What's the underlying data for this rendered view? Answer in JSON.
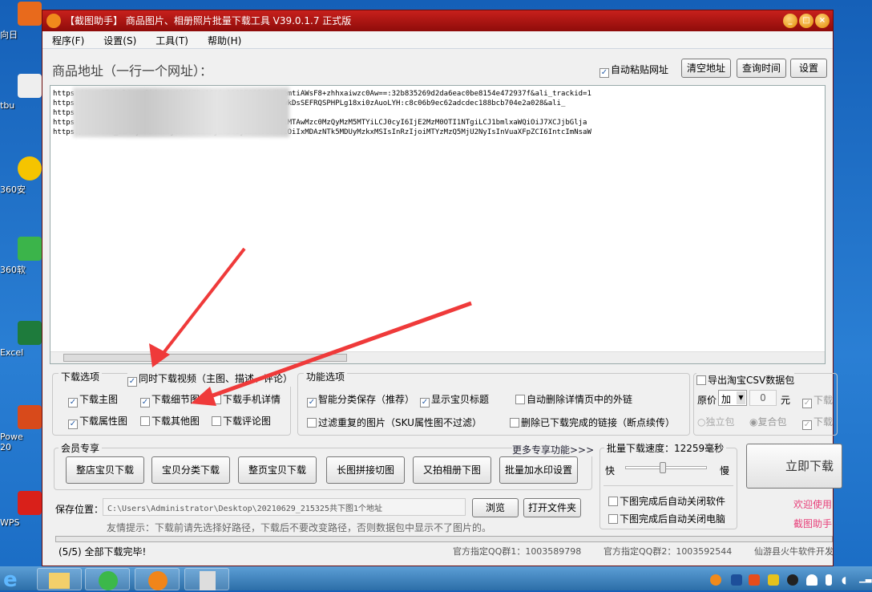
{
  "desktop": {
    "icons": [
      "向日",
      "tbu",
      "360安",
      "360软",
      "Excel",
      "Powe\n20",
      "WPS"
    ]
  },
  "window": {
    "title": "【截图助手】 商品图片、相册照片批量下载工具 V39.0.1.7 正式版"
  },
  "menu": [
    "程序(F)",
    "设置(S)",
    "工具(T)",
    "帮助(H)"
  ],
  "url_section": {
    "label": "商品地址（一行一个网址）：",
    "auto_paste": "自动粘贴网址",
    "clear_btn": "清空地址",
    "query_btn": "查询时间",
    "settings_btn": "设置",
    "lines": [
      "https://...870&ali_refid=a3_430673_1006:1105580960:N:emtiAWsF8+zhhxaiwzc0Aw==:32b835269d2da6eac0be8154e472937f&ali_trackid=1",
      "https:...&ali_refid=a3_430673_1006:1104163603:N:1C02MwkDsSEFRQSPHPLg18xi0zAuoLYH:c8c06b9ec62adcdec188bcb704e2a028&ali_",
      "https:",
      "https:/...sion_id=eyJhZCI6IjQ3IiwiY2giOiIyIiwic2t1IjoiMTAwMzc0MzQyMzM5MTYiLCJ0cyI6IjE2MzM0OTI1NTgiLCJ1bmlxaWQiOiJ7XCJjbGlja",
      "https:/...sion_id=eyJhZCI6IjE3NTUiLCJjaCI6IjIiLCJza3UiOiIxMDAzNTk5MDUyMzkxMSIsInRzIjoiMTYzMzQ5MjU2NyIsInVuaXFpZCI6IntcImNsaW"
    ]
  },
  "download_options": {
    "title": "下载选项",
    "video": "同时下载视频（主图、描述、评论）",
    "items": [
      {
        "label": "下载主图",
        "checked": true
      },
      {
        "label": "下载细节图",
        "checked": true
      },
      {
        "label": "下载手机详情",
        "checked": false
      },
      {
        "label": "下载属性图",
        "checked": true
      },
      {
        "label": "下载其他图",
        "checked": false
      },
      {
        "label": "下载评论图",
        "checked": false
      }
    ]
  },
  "function_options": {
    "title": "功能选项",
    "items": [
      {
        "label": "智能分类保存（推荐）",
        "checked": true
      },
      {
        "label": "显示宝贝标题",
        "checked": true
      },
      {
        "label": "自动删除详情页中的外链",
        "checked": false
      },
      {
        "label": "过滤重复的图片（SKU属性图不过滤）",
        "checked": false
      },
      {
        "label": "删除已下载完成的链接（断点续传）",
        "checked": false
      }
    ]
  },
  "csv": {
    "export": "导出淘宝CSV数据包",
    "price_label": "原价",
    "price_op": "加",
    "price_value": "0",
    "unit": "元",
    "single": "独立包",
    "combined": "复合包",
    "dl1": "下载",
    "dl2": "下载"
  },
  "member": {
    "title": "会员专享",
    "more": "更多专享功能>>>",
    "buttons": [
      "整店宝贝下载",
      "宝贝分类下载",
      "整页宝贝下载",
      "长图拼接切图",
      "又拍相册下图",
      "批量加水印设置"
    ]
  },
  "speed": {
    "label": "批量下载速度：12259毫秒",
    "fast": "快",
    "slow": "慢",
    "slider_fraction": 0.45,
    "close_app": "下图完成后自动关闭软件",
    "shutdown": "下图完成后自动关闭电脑"
  },
  "start_btn": "立即下载",
  "welcome1": "欢迎使用",
  "welcome2": "截图助手",
  "save": {
    "label": "保存位置：",
    "path": "C:\\Users\\Administrator\\Desktop\\20210629_215325共下图1个地址",
    "browse": "浏览",
    "open": "打开文件夹",
    "tip": "友情提示：下载前请先选择好路径，下载后不要改变路径，否则数据包中显示不了图片的。"
  },
  "status": {
    "msg": "(5/5) 全部下载完毕!",
    "qq1": "官方指定QQ群1：1003589798",
    "qq2": "官方指定QQ群2：1003592544",
    "company": "仙游县火牛软件开发"
  }
}
